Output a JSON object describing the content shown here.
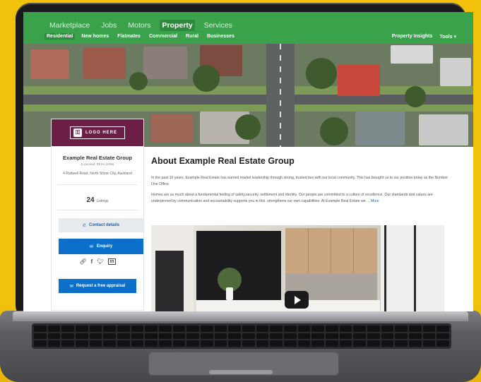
{
  "nav": {
    "items": [
      {
        "label": "Marketplace",
        "active": false
      },
      {
        "label": "Jobs",
        "active": false
      },
      {
        "label": "Motors",
        "active": false
      },
      {
        "label": "Property",
        "active": true
      },
      {
        "label": "Services",
        "active": false
      }
    ]
  },
  "subnav": {
    "items": [
      {
        "label": "Residential",
        "active": true
      },
      {
        "label": "New homes",
        "active": false
      },
      {
        "label": "Flatmates",
        "active": false
      },
      {
        "label": "Commercial",
        "active": false
      },
      {
        "label": "Rural",
        "active": false
      },
      {
        "label": "Businesses",
        "active": false
      }
    ],
    "right": {
      "insights": "Property Insights",
      "tools": "Tools"
    }
  },
  "agent": {
    "logo_text": "LOGO HERE",
    "name": "Example Real Estate Group",
    "licence": "(Licensed: REAA 2008)",
    "address": "4 Rodwell Road, North Shore City, Auckland",
    "listings_count": "24",
    "listings_label": "Listings",
    "contact_label": "Contact details",
    "enquiry_label": "Enquiry",
    "appraisal_label": "Request a free appraisal",
    "social_icons": [
      "link-icon",
      "facebook-icon",
      "twitter-icon",
      "linkedin-icon"
    ]
  },
  "about": {
    "title": "About Example Real Estate Group",
    "para1": "In the past 10 years, Example Real Estate has earned market leadership through strong, trusted ties with our local community. This has brought us to our position today as the Number One Office.",
    "para2": "Homes are as much about a fundamental feeling of safety,security, settlement and identity. Our people are committed to a culture of excellence. Our standards and values are underpinned by communication and accountability supports you in this. strengthens our own capabilities. At Example Real Estate we ...",
    "more": "More"
  },
  "colors": {
    "brand_green": "#3aa24b",
    "logo_bg": "#6b1f47",
    "primary_blue": "#0c6fc9",
    "page_bg": "#f2c10c"
  }
}
